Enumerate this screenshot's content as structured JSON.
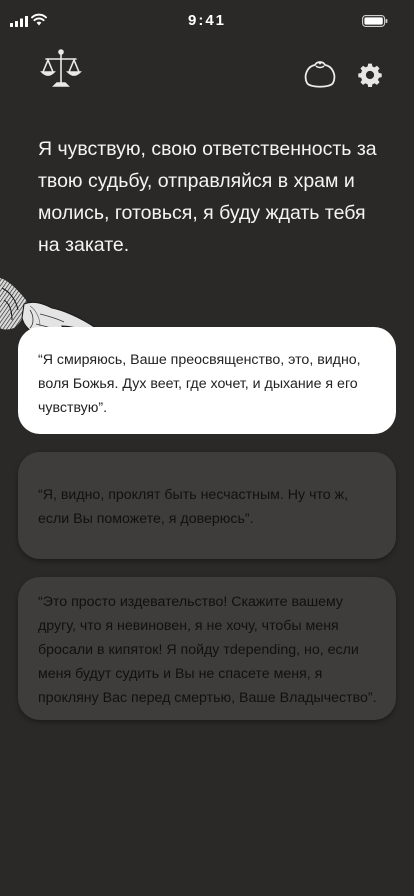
{
  "status_bar": {
    "time": "9:41",
    "icons": [
      "signal-icon",
      "wifi-icon",
      "battery-icon"
    ]
  },
  "toolbar": {
    "icons": [
      "scales-icon",
      "pouch-icon",
      "gear-icon"
    ]
  },
  "message": {
    "text": "Я чувствую, свою ответственность за твою судьбу, отправляйся в храм и молись, готовься, я буду ждать тебя на закате."
  },
  "choices": [
    {
      "text": "“Я смиряюсь, Ваше преосвященство, это, видно, воля Божья. Дух веет, где хочет, и дыхание я его чувствую”."
    },
    {
      "text": "“Я, видно, проклят быть несчастным. Ну что ж, если Вы поможете, я доверюсь”."
    },
    {
      "text": "“Это просто издевательство! Скажите вашему другу, что я невиновен, я не хочу, чтобы меня бросали в кипяток! Я пойду тdepending, но, если меня будут судить и Вы не спасете меня, я прокляну Вас перед смертью, Ваше Владычество”."
    }
  ],
  "colors": {
    "background": "#2a2927",
    "selected_choice": "#ffffff",
    "choice": "#3e3d3b"
  }
}
